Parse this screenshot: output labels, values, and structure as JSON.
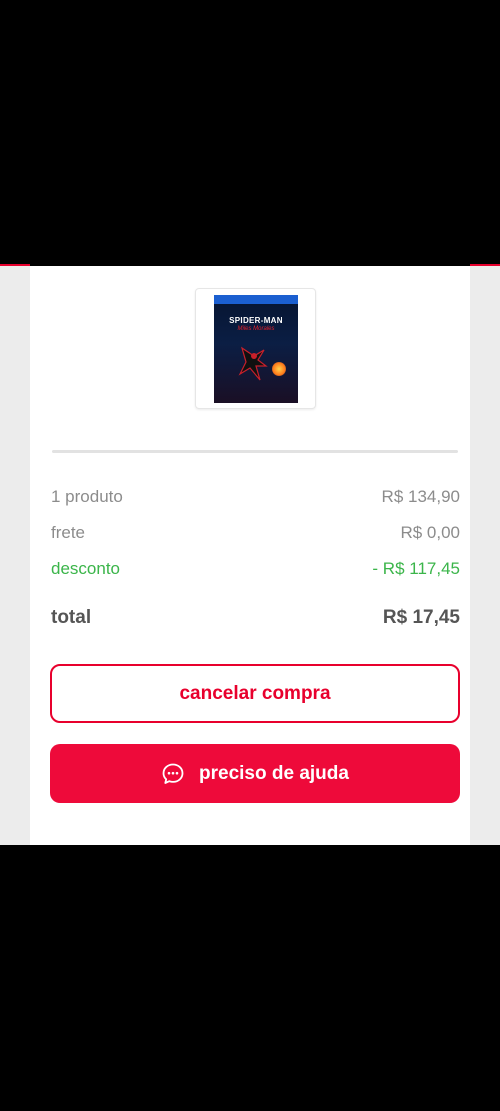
{
  "product": {
    "image_alt": "Marvel's Spider-Man Miles Morales PS5 cover",
    "cover_platform": "PS5",
    "cover_title": "SPIDER-MAN",
    "cover_subtitle": "Miles Morales"
  },
  "summary": {
    "items_label": "1 produto",
    "items_value": "R$ 134,90",
    "shipping_label": "frete",
    "shipping_value": "R$ 0,00",
    "discount_label": "desconto",
    "discount_value": "- R$ 117,45",
    "total_label": "total",
    "total_value": "R$ 17,45"
  },
  "actions": {
    "cancel_label": "cancelar compra",
    "help_label": "preciso de ajuda"
  },
  "colors": {
    "brand_red": "#e8002d",
    "discount_green": "#3bb54a",
    "muted_text": "#8c8c8c"
  },
  "icons": {
    "help": "chat-bubble-icon"
  }
}
